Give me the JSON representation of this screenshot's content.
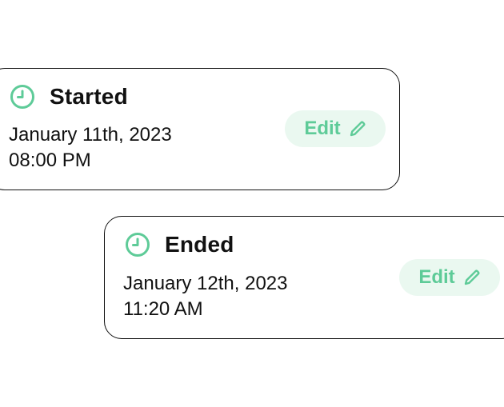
{
  "colors": {
    "accent": "#5ecb98",
    "accent_bg": "#eaf8f0",
    "text": "#111111",
    "border": "#111111"
  },
  "cards": [
    {
      "icon": "clock-icon",
      "title": "Started",
      "date": "January 11th, 2023",
      "time": "08:00 PM",
      "edit_label": "Edit",
      "edit_icon": "pencil-icon"
    },
    {
      "icon": "clock-icon",
      "title": "Ended",
      "date": "January 12th, 2023",
      "time": "11:20 AM",
      "edit_label": "Edit",
      "edit_icon": "pencil-icon"
    }
  ]
}
